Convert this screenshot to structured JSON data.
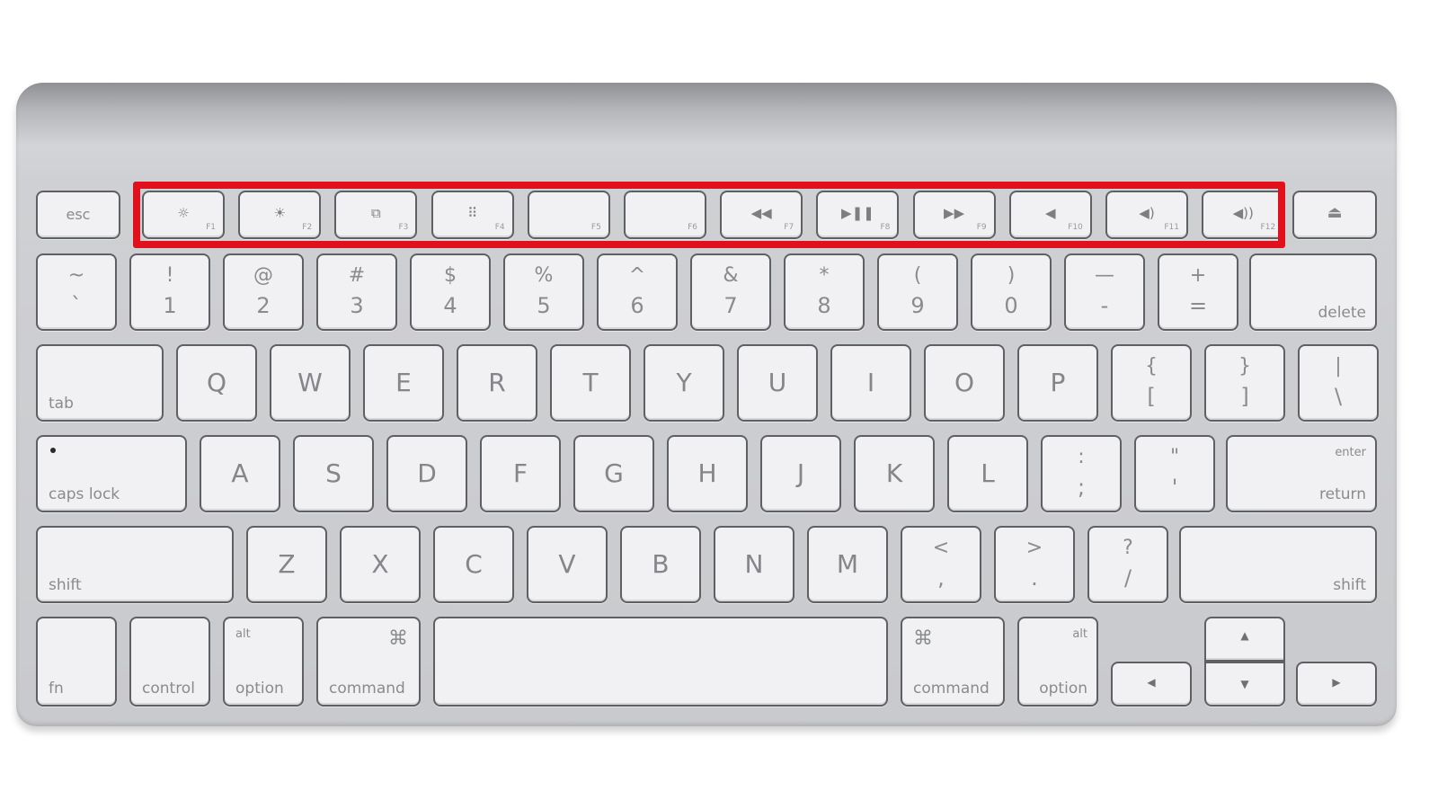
{
  "highlight": {
    "label": "function-key-row",
    "color": "#e0101c"
  },
  "fn_row": {
    "esc": "esc",
    "fkeys": [
      {
        "num": "F1",
        "icon": "☼",
        "icon_name": "brightness-down-icon"
      },
      {
        "num": "F2",
        "icon": "☀",
        "icon_name": "brightness-up-icon"
      },
      {
        "num": "F3",
        "icon": "⧉",
        "icon_name": "expose-icon"
      },
      {
        "num": "F4",
        "icon": "⠿",
        "icon_name": "dashboard-icon"
      },
      {
        "num": "F5",
        "icon": "",
        "icon_name": "blank"
      },
      {
        "num": "F6",
        "icon": "",
        "icon_name": "blank"
      },
      {
        "num": "F7",
        "icon": "◀◀",
        "icon_name": "rewind-icon"
      },
      {
        "num": "F8",
        "icon": "▶❚❚",
        "icon_name": "play-pause-icon"
      },
      {
        "num": "F9",
        "icon": "▶▶",
        "icon_name": "fast-forward-icon"
      },
      {
        "num": "F10",
        "icon": "◀",
        "icon_name": "mute-icon"
      },
      {
        "num": "F11",
        "icon": "◀)",
        "icon_name": "volume-down-icon"
      },
      {
        "num": "F12",
        "icon": "◀))",
        "icon_name": "volume-up-icon"
      }
    ],
    "eject": "⏏"
  },
  "number_row": {
    "keys": [
      {
        "top": "~",
        "bot": "`"
      },
      {
        "top": "!",
        "bot": "1"
      },
      {
        "top": "@",
        "bot": "2"
      },
      {
        "top": "#",
        "bot": "3"
      },
      {
        "top": "$",
        "bot": "4"
      },
      {
        "top": "%",
        "bot": "5"
      },
      {
        "top": "^",
        "bot": "6"
      },
      {
        "top": "&",
        "bot": "7"
      },
      {
        "top": "*",
        "bot": "8"
      },
      {
        "top": "(",
        "bot": "9"
      },
      {
        "top": ")",
        "bot": "0"
      },
      {
        "top": "—",
        "bot": "-"
      },
      {
        "top": "+",
        "bot": "="
      }
    ],
    "delete": "delete"
  },
  "qwerty_row": {
    "tab": "tab",
    "letters": [
      "Q",
      "W",
      "E",
      "R",
      "T",
      "Y",
      "U",
      "I",
      "O",
      "P"
    ],
    "symbols": [
      {
        "top": "{",
        "bot": "["
      },
      {
        "top": "}",
        "bot": "]"
      },
      {
        "top": "|",
        "bot": "\\"
      }
    ]
  },
  "home_row": {
    "caps": "caps lock",
    "letters": [
      "A",
      "S",
      "D",
      "F",
      "G",
      "H",
      "J",
      "K",
      "L"
    ],
    "symbols": [
      {
        "top": ":",
        "bot": ";"
      },
      {
        "top": "\"",
        "bot": "'"
      }
    ],
    "enter": "enter",
    "return": "return"
  },
  "shift_row": {
    "shift_left": "shift",
    "letters": [
      "Z",
      "X",
      "C",
      "V",
      "B",
      "N",
      "M"
    ],
    "symbols": [
      {
        "top": "<",
        "bot": ","
      },
      {
        "top": ">",
        "bot": "."
      },
      {
        "top": "?",
        "bot": "/"
      }
    ],
    "shift_right": "shift"
  },
  "bottom_row": {
    "fn": "fn",
    "control": "control",
    "alt": "alt",
    "option": "option",
    "command": "command",
    "cmd_symbol": "⌘",
    "arrows": {
      "up": "▲",
      "down": "▼",
      "left": "◀",
      "right": "▶"
    }
  }
}
